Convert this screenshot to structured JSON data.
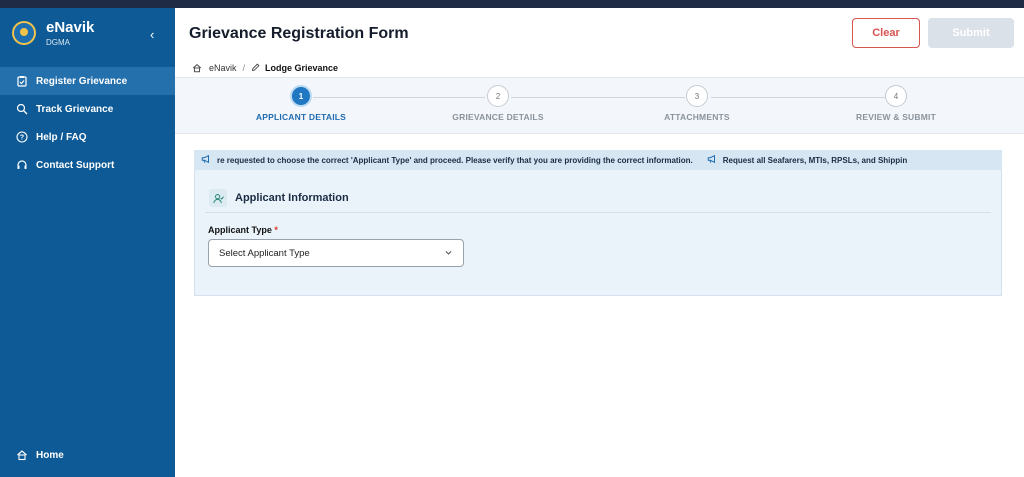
{
  "app": {
    "title": "eNavik",
    "subtitle": "DGMA",
    "collapse_icon": "chevron-left-icon"
  },
  "sidebar": {
    "items": [
      {
        "label": "Register Grievance",
        "icon": "clipboard-icon",
        "active": true
      },
      {
        "label": "Track Grievance",
        "icon": "search-icon",
        "active": false
      },
      {
        "label": "Help / FAQ",
        "icon": "help-circle-icon",
        "active": false
      },
      {
        "label": "Contact Support",
        "icon": "headset-icon",
        "active": false
      }
    ],
    "home": {
      "label": "Home",
      "icon": "home-icon"
    }
  },
  "header": {
    "title": "Grievance Registration Form",
    "clear_label": "Clear",
    "submit_label": "Submit"
  },
  "breadcrumb": {
    "root": "eNavik",
    "separator": "/",
    "current": "Lodge Grievance"
  },
  "stepper": {
    "steps": [
      {
        "num": "1",
        "label": "APPLICANT DETAILS",
        "active": true
      },
      {
        "num": "2",
        "label": "GRIEVANCE DETAILS",
        "active": false
      },
      {
        "num": "3",
        "label": "ATTACHMENTS",
        "active": false
      },
      {
        "num": "4",
        "label": "REVIEW & SUBMIT",
        "active": false
      }
    ]
  },
  "ticker": {
    "message1": "re requested to choose the correct 'Applicant Type' and proceed. Please verify that you are providing the correct information.",
    "message2": "Request all Seafarers, MTIs, RPSLs, and Shippin"
  },
  "applicant": {
    "section_title": "Applicant Information",
    "type_label": "Applicant Type",
    "required_mark": "*",
    "type_value": "Select Applicant Type"
  },
  "colors": {
    "sidebar": "#0d5a96",
    "accent": "#1f78c1",
    "danger": "#d9534f"
  }
}
